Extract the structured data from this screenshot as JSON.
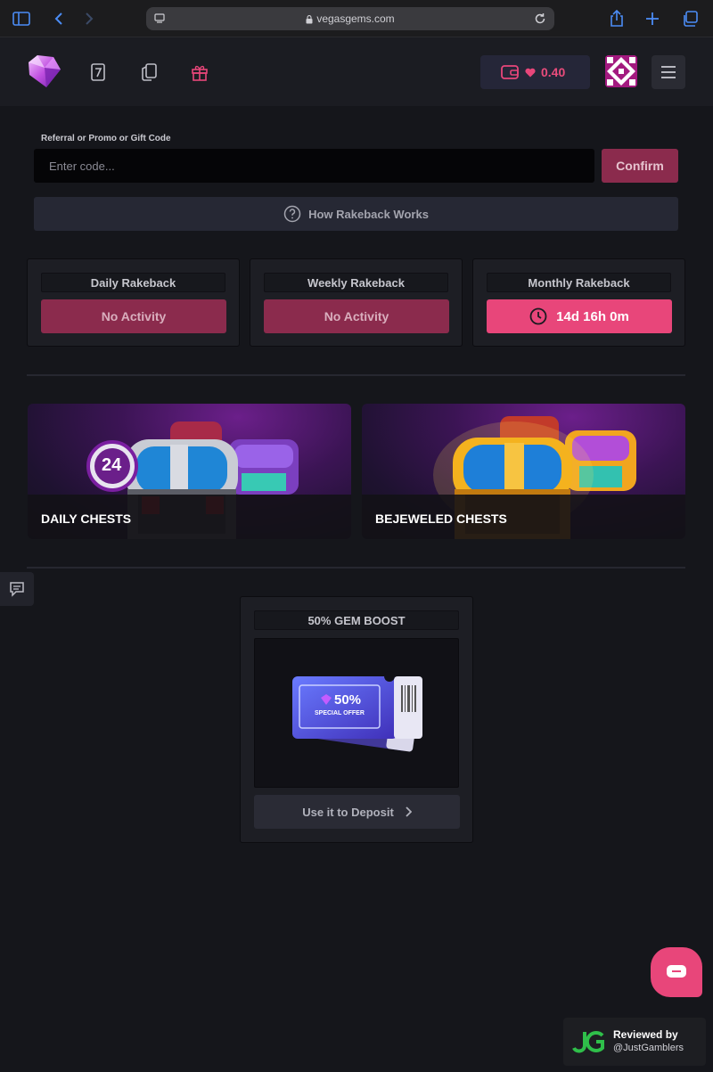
{
  "browser": {
    "url": "vegasgems.com"
  },
  "header": {
    "balance": "0.40",
    "colors": {
      "accent": "#e8467a",
      "muted_accent": "#8b2b4d"
    }
  },
  "code_section": {
    "label": "Referral or Promo or Gift Code",
    "placeholder": "Enter code...",
    "confirm_label": "Confirm",
    "help_label": "How Rakeback Works"
  },
  "rakeback": [
    {
      "title": "Daily Rakeback",
      "status": "No Activity",
      "active": false
    },
    {
      "title": "Weekly Rakeback",
      "status": "No Activity",
      "active": false
    },
    {
      "title": "Monthly Rakeback",
      "status": "14d 16h 0m",
      "active": true
    }
  ],
  "chests": [
    {
      "label": "DAILY CHESTS",
      "badge": "24"
    },
    {
      "label": "BEJEWELED CHESTS"
    }
  ],
  "boost": {
    "title": "50% GEM BOOST",
    "ticket_value": "50%",
    "ticket_text": "SPECIAL OFFER",
    "cta_label": "Use it to Deposit"
  },
  "review": {
    "line1": "Reviewed by",
    "line2": "@JustGamblers"
  }
}
